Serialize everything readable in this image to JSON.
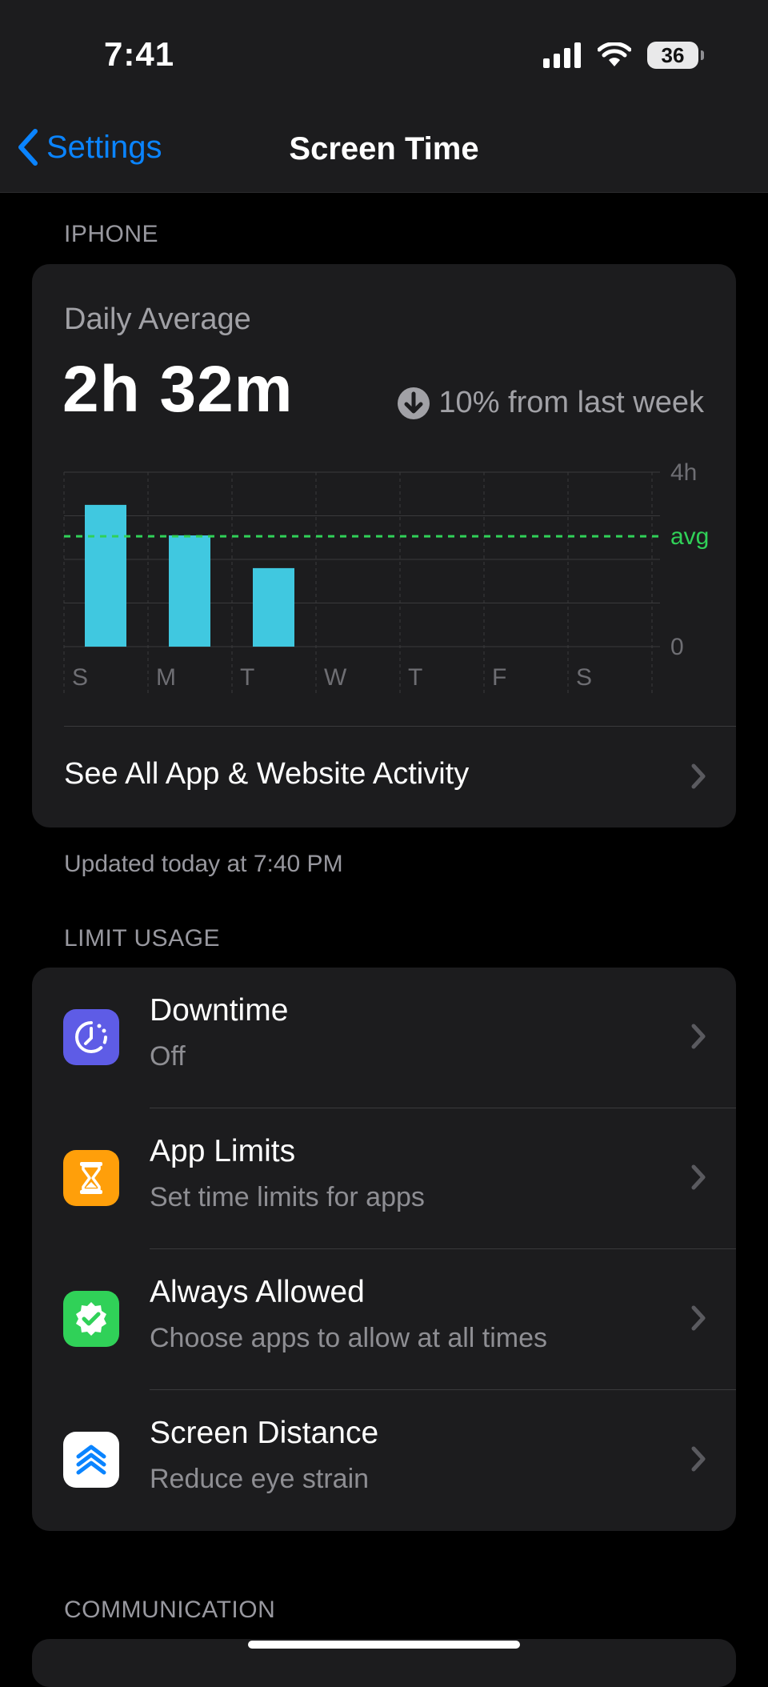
{
  "status_bar": {
    "time": "7:41",
    "battery": "36"
  },
  "nav": {
    "back_label": "Settings",
    "title": "Screen Time"
  },
  "iphone_section": {
    "header": "IPHONE",
    "daily_average_label": "Daily Average",
    "daily_average_value": "2h 32m",
    "delta_text": "10% from last week",
    "see_all_label": "See All App & Website Activity",
    "updated_text": "Updated today at 7:40 PM"
  },
  "chart_data": {
    "type": "bar",
    "categories": [
      "S",
      "M",
      "T",
      "W",
      "T",
      "F",
      "S"
    ],
    "values": [
      3.25,
      2.55,
      1.8,
      null,
      null,
      null,
      null
    ],
    "average": 2.53,
    "ylim": [
      0,
      4
    ],
    "y_tick_labels": {
      "top": "4h",
      "avg": "avg",
      "bottom": "0"
    },
    "colors": {
      "bar": "#40c8e0",
      "avg_line": "#30d158",
      "grid": "#3a3a3c"
    }
  },
  "limit_section": {
    "header": "LIMIT USAGE",
    "items": [
      {
        "title": "Downtime",
        "subtitle": "Off",
        "icon": "downtime-icon",
        "color": "#5e5ce6"
      },
      {
        "title": "App Limits",
        "subtitle": "Set time limits for apps",
        "icon": "hourglass-icon",
        "color": "#ff9f0a"
      },
      {
        "title": "Always Allowed",
        "subtitle": "Choose apps to allow at all times",
        "icon": "checkmark-badge-icon",
        "color": "#30d158"
      },
      {
        "title": "Screen Distance",
        "subtitle": "Reduce eye strain",
        "icon": "screen-distance-icon",
        "color": "#ffffff"
      }
    ]
  },
  "communication_section": {
    "header": "COMMUNICATION"
  }
}
